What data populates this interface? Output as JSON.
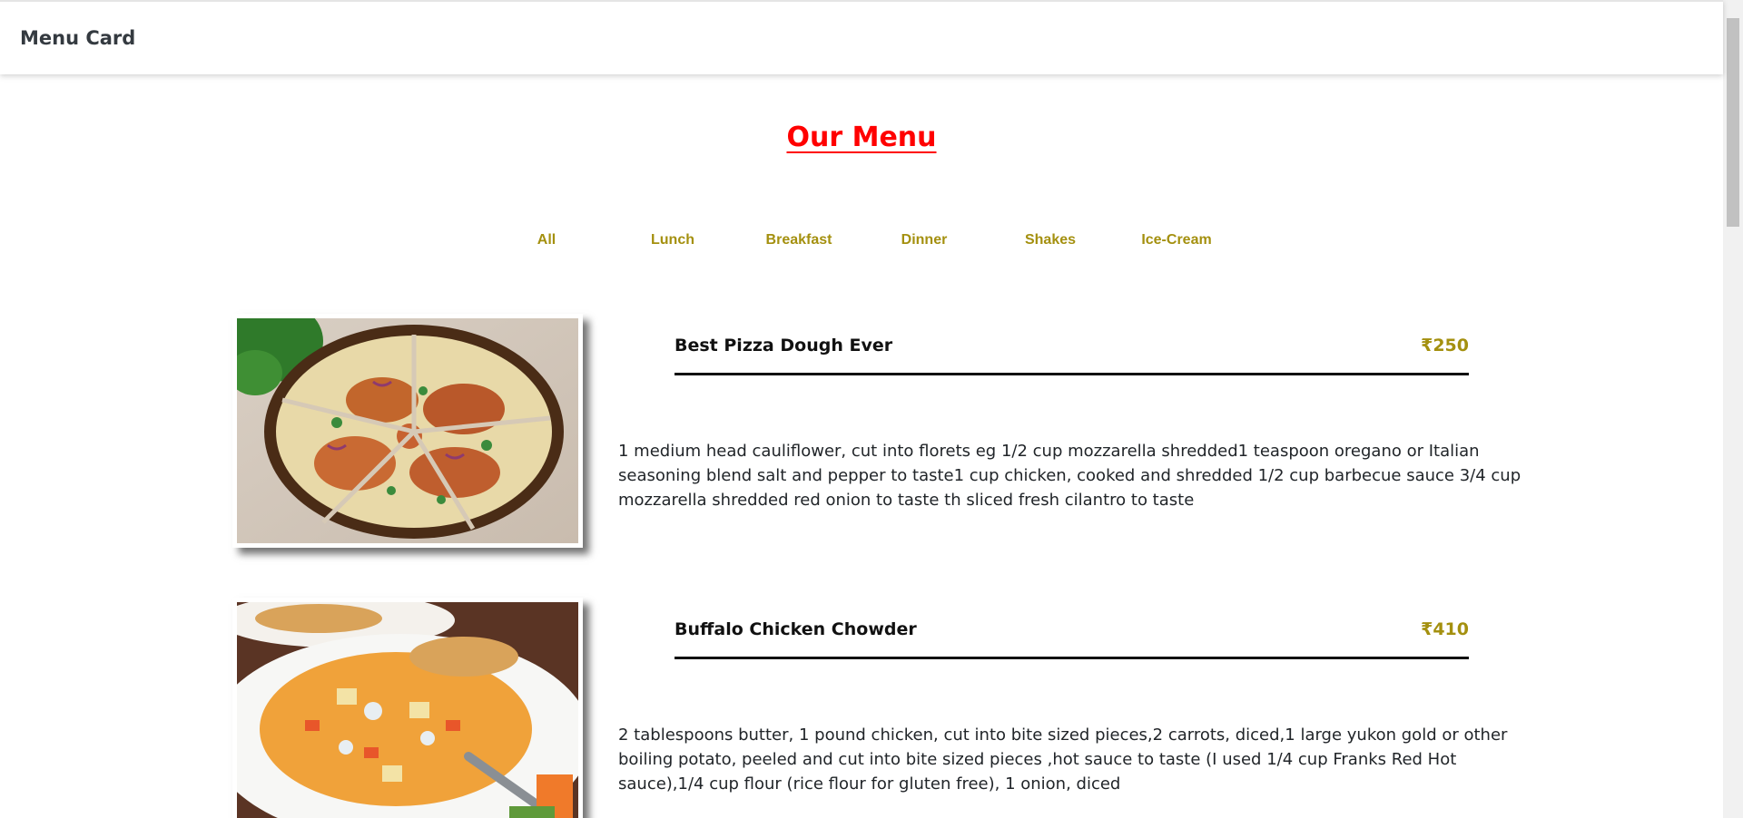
{
  "navbar": {
    "brand": "Menu Card"
  },
  "heading": "Our Menu",
  "filters": [
    {
      "label": "All"
    },
    {
      "label": "Lunch"
    },
    {
      "label": "Breakfast"
    },
    {
      "label": "Dinner"
    },
    {
      "label": "Shakes"
    },
    {
      "label": "Ice-Cream"
    }
  ],
  "items": [
    {
      "name": "Best Pizza Dough Ever",
      "price": "₹250",
      "description": "1 medium head cauliflower, cut into florets eg 1/2 cup mozzarella shredded1 teaspoon oregano or Italian seasoning blend salt and pepper to taste1 cup chicken, cooked and shredded 1/2 cup barbecue sauce 3/4 cup mozzarella shredded red onion to taste th sliced fresh cilantro to taste"
    },
    {
      "name": "Buffalo Chicken Chowder",
      "price": "₹410",
      "description": "2 tablespoons butter, 1 pound chicken, cut into bite sized pieces,2 carrots, diced,1 large yukon gold or other boiling potato, peeled and cut into bite sized pieces ,hot sauce to taste (I used 1/4 cup Franks Red Hot sauce),1/4 cup flour (rice flour for gluten free), 1 onion, diced"
    }
  ],
  "colors": {
    "accent": "#a4900f",
    "heading": "#ff0000"
  }
}
